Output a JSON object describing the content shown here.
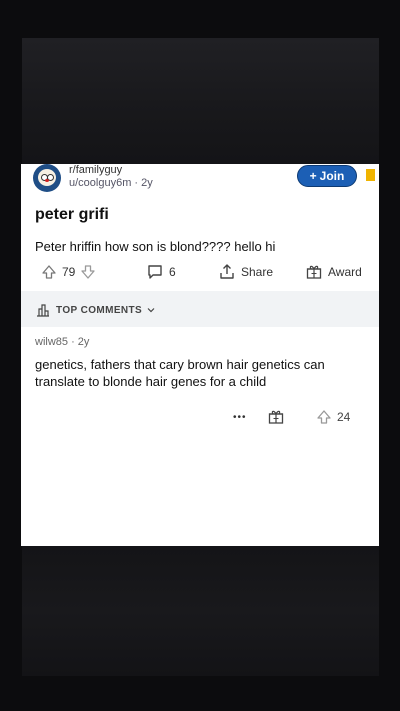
{
  "post": {
    "subreddit": "r/familyguy",
    "author_line": "u/coolguy6m · 2y",
    "join_label": "Join",
    "title": "peter grifi",
    "body": "Peter hriffin how son is blond???? hello hi",
    "votes": "79",
    "comments": "6",
    "share_label": "Share",
    "award_label": "Award"
  },
  "comments_section": {
    "sort_label": "TOP COMMENTS"
  },
  "top_comment": {
    "author_line": "wilw85 · 2y",
    "text": "genetics, fathers that cary brown hair genetics can translate to blonde hair genes for a child",
    "more_label": "•••",
    "votes": "24"
  },
  "colors": {
    "accent": "#1c5fb5",
    "save": "#f0b400",
    "background": "#0c0c0e"
  },
  "icons": [
    "upvote-icon",
    "downvote-icon",
    "comment-icon",
    "share-icon",
    "award-icon",
    "trophy-icon",
    "chevron-down-icon",
    "plus-icon",
    "bookmark-icon"
  ]
}
